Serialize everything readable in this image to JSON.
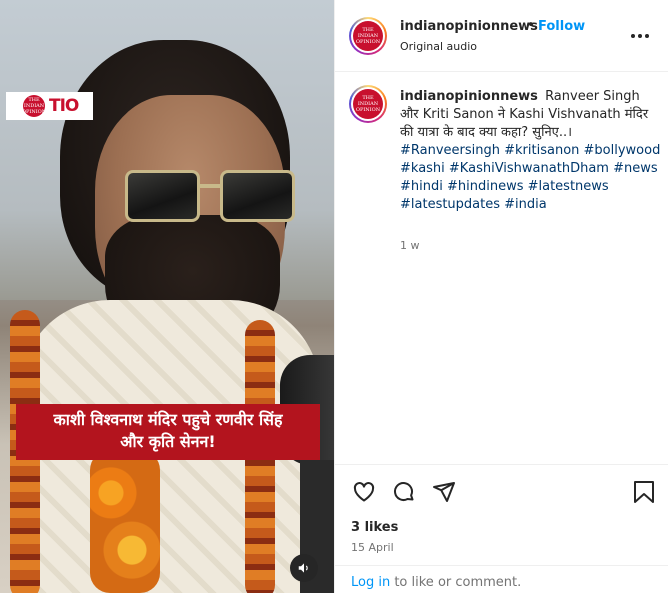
{
  "media": {
    "logo_text": "TIO",
    "logo_seal": "THE INDIAN OPINION",
    "caption_line1": "काशी विश्वनाथ मंदिर पहुचे रणवीर सिंह",
    "caption_line2": "और कृति सेनन!",
    "sound_icon": "speaker-icon"
  },
  "header": {
    "username": "indianopinionnews",
    "separator": "•",
    "follow_label": "Follow",
    "audio_label": "Original audio",
    "avatar_seal": "THE INDIAN OPINION"
  },
  "caption": {
    "username": "indianopinionnews",
    "text": "Ranveer Singh और Kriti Sanon ने Kashi Vishvanath मंदिर की यात्रा के बाद क्या कहा? सुनिए..।",
    "hashtags": "#Ranveersingh #kritisanon #bollywood #kashi #KashiVishwanathDham #news #hindi #hindinews #latestnews #latestupdates #india",
    "time": "1 w"
  },
  "engagement": {
    "likes": "3 likes",
    "date": "15 April",
    "login_link": "Log in",
    "login_suffix": " to like or comment."
  },
  "colors": {
    "accent_blue": "#0095f6",
    "hashtag_blue": "#00376b",
    "caption_red": "#b3141e",
    "brand_red": "#c8102e"
  }
}
